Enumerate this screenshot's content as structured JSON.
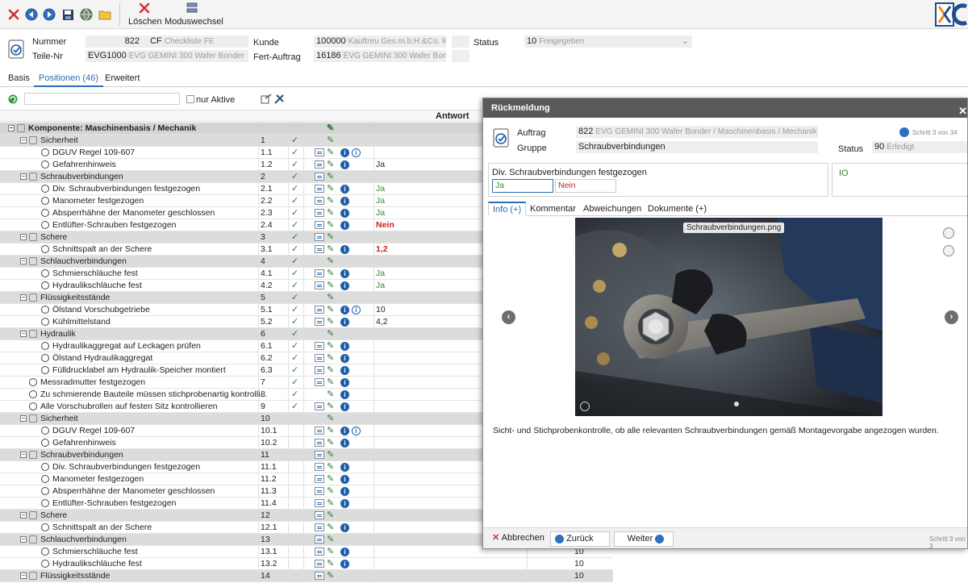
{
  "toolbar": {
    "delete_label": "Löschen",
    "mode_label": "Moduswechsel",
    "colors": {
      "close": "#d32f2f",
      "nav": "#1f5fa8"
    }
  },
  "header": {
    "nummer_label": "Nummer",
    "nummer_value": "822",
    "nummer_code": "CF",
    "nummer_desc": "Checkliste FE",
    "teile_label": "Teile-Nr",
    "teile_value": "EVG1000",
    "teile_desc": "EVG GEMINI 300 Wafer Bonder",
    "kunde_label": "Kunde",
    "kunde_value": "100000",
    "kunde_desc": "Kauftreu Ges.m.b.H.&Co. KG",
    "fert_label": "Fert-Auftrag",
    "fert_value": "16186",
    "fert_desc": "EVG GEMINI 300 Wafer Bonder",
    "status_label": "Status",
    "status_value": "10",
    "status_desc": "Freigegeben"
  },
  "tabs": [
    "Basis",
    "Positionen (46)",
    "Erweitert"
  ],
  "filter": {
    "nur_aktive": "nur Aktive"
  },
  "grid": {
    "col_antwort": "Antwort",
    "rows": [
      {
        "type": "top",
        "label": "Komponente: Maschinenbasis / Mechanik",
        "num": "",
        "check": false,
        "list": false,
        "info": false,
        "info2": false,
        "ans": "",
        "ansClass": "",
        "right": ""
      },
      {
        "type": "group",
        "label": "Sicherheit",
        "num": "1",
        "check": true,
        "list": false,
        "info": false,
        "info2": false,
        "ans": "",
        "ansClass": "",
        "right": ""
      },
      {
        "type": "item",
        "label": "DGUV Regel 109-607",
        "num": "1.1",
        "check": true,
        "list": true,
        "info": true,
        "info2": true,
        "ans": "",
        "ansClass": "",
        "right": ""
      },
      {
        "type": "item",
        "label": "Gefahrenhinweis",
        "num": "1.2",
        "check": true,
        "list": true,
        "info": true,
        "info2": false,
        "ans": "Ja",
        "ansClass": "",
        "right": ""
      },
      {
        "type": "group",
        "label": "Schraubverbindungen",
        "num": "2",
        "check": true,
        "list": true,
        "info": false,
        "info2": false,
        "ans": "",
        "ansClass": "",
        "right": ""
      },
      {
        "type": "item",
        "label": "Div. Schraubverbindungen festgezogen",
        "num": "2.1",
        "check": true,
        "list": true,
        "info": true,
        "info2": false,
        "ans": "Ja",
        "ansClass": "ans-green",
        "right": ""
      },
      {
        "type": "item",
        "label": "Manometer festgezogen",
        "num": "2.2",
        "check": true,
        "list": true,
        "info": true,
        "info2": false,
        "ans": "Ja",
        "ansClass": "ans-green",
        "right": ""
      },
      {
        "type": "item",
        "label": "Absperrhähne der Manometer geschlossen",
        "num": "2.3",
        "check": true,
        "list": true,
        "info": true,
        "info2": false,
        "ans": "Ja",
        "ansClass": "ans-green",
        "right": ""
      },
      {
        "type": "item",
        "label": "Entlüfter-Schrauben festgezogen",
        "num": "2.4",
        "check": true,
        "list": true,
        "info": true,
        "info2": false,
        "ans": "Nein",
        "ansClass": "ans-red",
        "right": ""
      },
      {
        "type": "group",
        "label": "Schere",
        "num": "3",
        "check": true,
        "list": true,
        "info": false,
        "info2": false,
        "ans": "",
        "ansClass": "",
        "right": ""
      },
      {
        "type": "item",
        "label": "Schnittspalt an der Schere",
        "num": "3.1",
        "check": true,
        "list": true,
        "info": true,
        "info2": false,
        "ans": "1,2",
        "ansClass": "ans-red",
        "right": ""
      },
      {
        "type": "group",
        "label": "Schlauchverbindungen",
        "num": "4",
        "check": true,
        "list": false,
        "info": false,
        "info2": false,
        "ans": "",
        "ansClass": "",
        "right": ""
      },
      {
        "type": "item",
        "label": "Schmierschläuche fest",
        "num": "4.1",
        "check": true,
        "list": true,
        "info": true,
        "info2": false,
        "ans": "Ja",
        "ansClass": "ans-green",
        "right": ""
      },
      {
        "type": "item",
        "label": "Hydraulikschläuche fest",
        "num": "4.2",
        "check": true,
        "list": true,
        "info": true,
        "info2": false,
        "ans": "Ja",
        "ansClass": "ans-green",
        "right": ""
      },
      {
        "type": "group",
        "label": "Flüssigkeitsstände",
        "num": "5",
        "check": true,
        "list": false,
        "info": false,
        "info2": false,
        "ans": "",
        "ansClass": "",
        "right": ""
      },
      {
        "type": "item",
        "label": "Ölstand Vorschubgetriebe",
        "num": "5.1",
        "check": true,
        "list": true,
        "info": true,
        "info2": true,
        "ans": "10",
        "ansClass": "",
        "right": ""
      },
      {
        "type": "item",
        "label": "Kühlmittelstand",
        "num": "5.2",
        "check": true,
        "list": true,
        "info": true,
        "info2": false,
        "ans": "4,2",
        "ansClass": "",
        "right": ""
      },
      {
        "type": "group",
        "label": "Hydraulik",
        "num": "6",
        "check": true,
        "list": false,
        "info": false,
        "info2": false,
        "ans": "",
        "ansClass": "",
        "right": ""
      },
      {
        "type": "item",
        "label": "Hydraulikaggregat auf Leckagen prüfen",
        "num": "6.1",
        "check": true,
        "list": true,
        "info": true,
        "info2": false,
        "ans": "",
        "ansClass": "",
        "right": ""
      },
      {
        "type": "item",
        "label": "Ölstand Hydraulikaggregat",
        "num": "6.2",
        "check": true,
        "list": true,
        "info": true,
        "info2": false,
        "ans": "",
        "ansClass": "",
        "right": ""
      },
      {
        "type": "item",
        "label": "Fülldrucklabel am Hydraulik-Speicher montiert",
        "num": "6.3",
        "check": true,
        "list": true,
        "info": true,
        "info2": false,
        "ans": "",
        "ansClass": "",
        "right": ""
      },
      {
        "type": "plain",
        "label": "Messradmutter festgezogen",
        "num": "7",
        "check": true,
        "list": true,
        "info": true,
        "info2": false,
        "ans": "",
        "ansClass": "",
        "right": ""
      },
      {
        "type": "plain",
        "label": "Zu schmierende Bauteile müssen stichprobenartig kontrolli...",
        "num": "8",
        "check": true,
        "list": false,
        "info": true,
        "info2": false,
        "ans": "",
        "ansClass": "",
        "right": ""
      },
      {
        "type": "plain",
        "label": "Alle Vorschubrollen auf festen Sitz kontrollieren",
        "num": "9",
        "check": true,
        "list": true,
        "info": true,
        "info2": false,
        "ans": "",
        "ansClass": "",
        "right": ""
      },
      {
        "type": "group",
        "label": "Sicherheit",
        "num": "10",
        "check": false,
        "list": false,
        "info": false,
        "info2": false,
        "ans": "",
        "ansClass": "",
        "right": ""
      },
      {
        "type": "item",
        "label": "DGUV Regel 109-607",
        "num": "10.1",
        "check": false,
        "list": true,
        "info": true,
        "info2": true,
        "ans": "",
        "ansClass": "",
        "right": ""
      },
      {
        "type": "item",
        "label": "Gefahrenhinweis",
        "num": "10.2",
        "check": false,
        "list": true,
        "info": true,
        "info2": false,
        "ans": "",
        "ansClass": "",
        "right": ""
      },
      {
        "type": "group",
        "label": "Schraubverbindungen",
        "num": "11",
        "check": false,
        "list": true,
        "info": false,
        "info2": false,
        "ans": "",
        "ansClass": "",
        "right": ""
      },
      {
        "type": "item",
        "label": "Div. Schraubverbindungen festgezogen",
        "num": "11.1",
        "check": false,
        "list": true,
        "info": true,
        "info2": false,
        "ans": "",
        "ansClass": "",
        "right": ""
      },
      {
        "type": "item",
        "label": "Manometer festgezogen",
        "num": "11.2",
        "check": false,
        "list": true,
        "info": true,
        "info2": false,
        "ans": "",
        "ansClass": "",
        "right": ""
      },
      {
        "type": "item",
        "label": "Absperrhähne der Manometer geschlossen",
        "num": "11.3",
        "check": false,
        "list": true,
        "info": true,
        "info2": false,
        "ans": "",
        "ansClass": "",
        "right": ""
      },
      {
        "type": "item",
        "label": "Entlüfter-Schrauben festgezogen",
        "num": "11.4",
        "check": false,
        "list": true,
        "info": true,
        "info2": false,
        "ans": "",
        "ansClass": "",
        "right": ""
      },
      {
        "type": "group",
        "label": "Schere",
        "num": "12",
        "check": false,
        "list": true,
        "info": false,
        "info2": false,
        "ans": "",
        "ansClass": "",
        "right": ""
      },
      {
        "type": "item",
        "label": "Schnittspalt an der Schere",
        "num": "12.1",
        "check": false,
        "list": true,
        "info": true,
        "info2": false,
        "ans": "",
        "ansClass": "",
        "right": "10"
      },
      {
        "type": "group",
        "label": "Schlauchverbindungen",
        "num": "13",
        "check": false,
        "list": true,
        "info": false,
        "info2": false,
        "ans": "",
        "ansClass": "",
        "right": "10"
      },
      {
        "type": "item",
        "label": "Schmierschläuche fest",
        "num": "13.1",
        "check": false,
        "list": true,
        "info": true,
        "info2": false,
        "ans": "",
        "ansClass": "",
        "right": "10"
      },
      {
        "type": "item",
        "label": "Hydraulikschläuche fest",
        "num": "13.2",
        "check": false,
        "list": true,
        "info": true,
        "info2": false,
        "ans": "",
        "ansClass": "",
        "right": "10"
      },
      {
        "type": "group",
        "label": "Flüssigkeitsstände",
        "num": "14",
        "check": false,
        "list": true,
        "info": false,
        "info2": false,
        "ans": "",
        "ansClass": "",
        "right": "10"
      }
    ]
  },
  "dialog": {
    "title": "Rückmeldung",
    "auftrag_label": "Auftrag",
    "auftrag_value": "822",
    "auftrag_desc": "EVG GEMINI 300 Wafer Bonder / Maschinenbasis / Mechanik",
    "gruppe_label": "Gruppe",
    "gruppe_value": "Schraubverbindungen",
    "status_label": "Status",
    "status_value": "90",
    "status_desc": "Erledigt",
    "step_text": "Schritt 3 von 34",
    "question": "Div. Schraubverbindungen festgezogen",
    "answer_ja": "Ja",
    "answer_nein": "Nein",
    "io_label": "IO",
    "tabs": [
      "Info (+)",
      "Kommentar",
      "Abweichungen",
      "Dokumente (+)"
    ],
    "image_label": "Schraubverbindungen.png",
    "description": "Sicht- und Stichprobenkontrolle, ob alle relevanten Schraubverbindungen gemäß Montagevorgabe angezogen wurden.",
    "btn_cancel": "Abbrechen",
    "btn_back": "Zurück",
    "btn_next": "Weiter",
    "footer_step": "Schritt 3 von 3"
  }
}
